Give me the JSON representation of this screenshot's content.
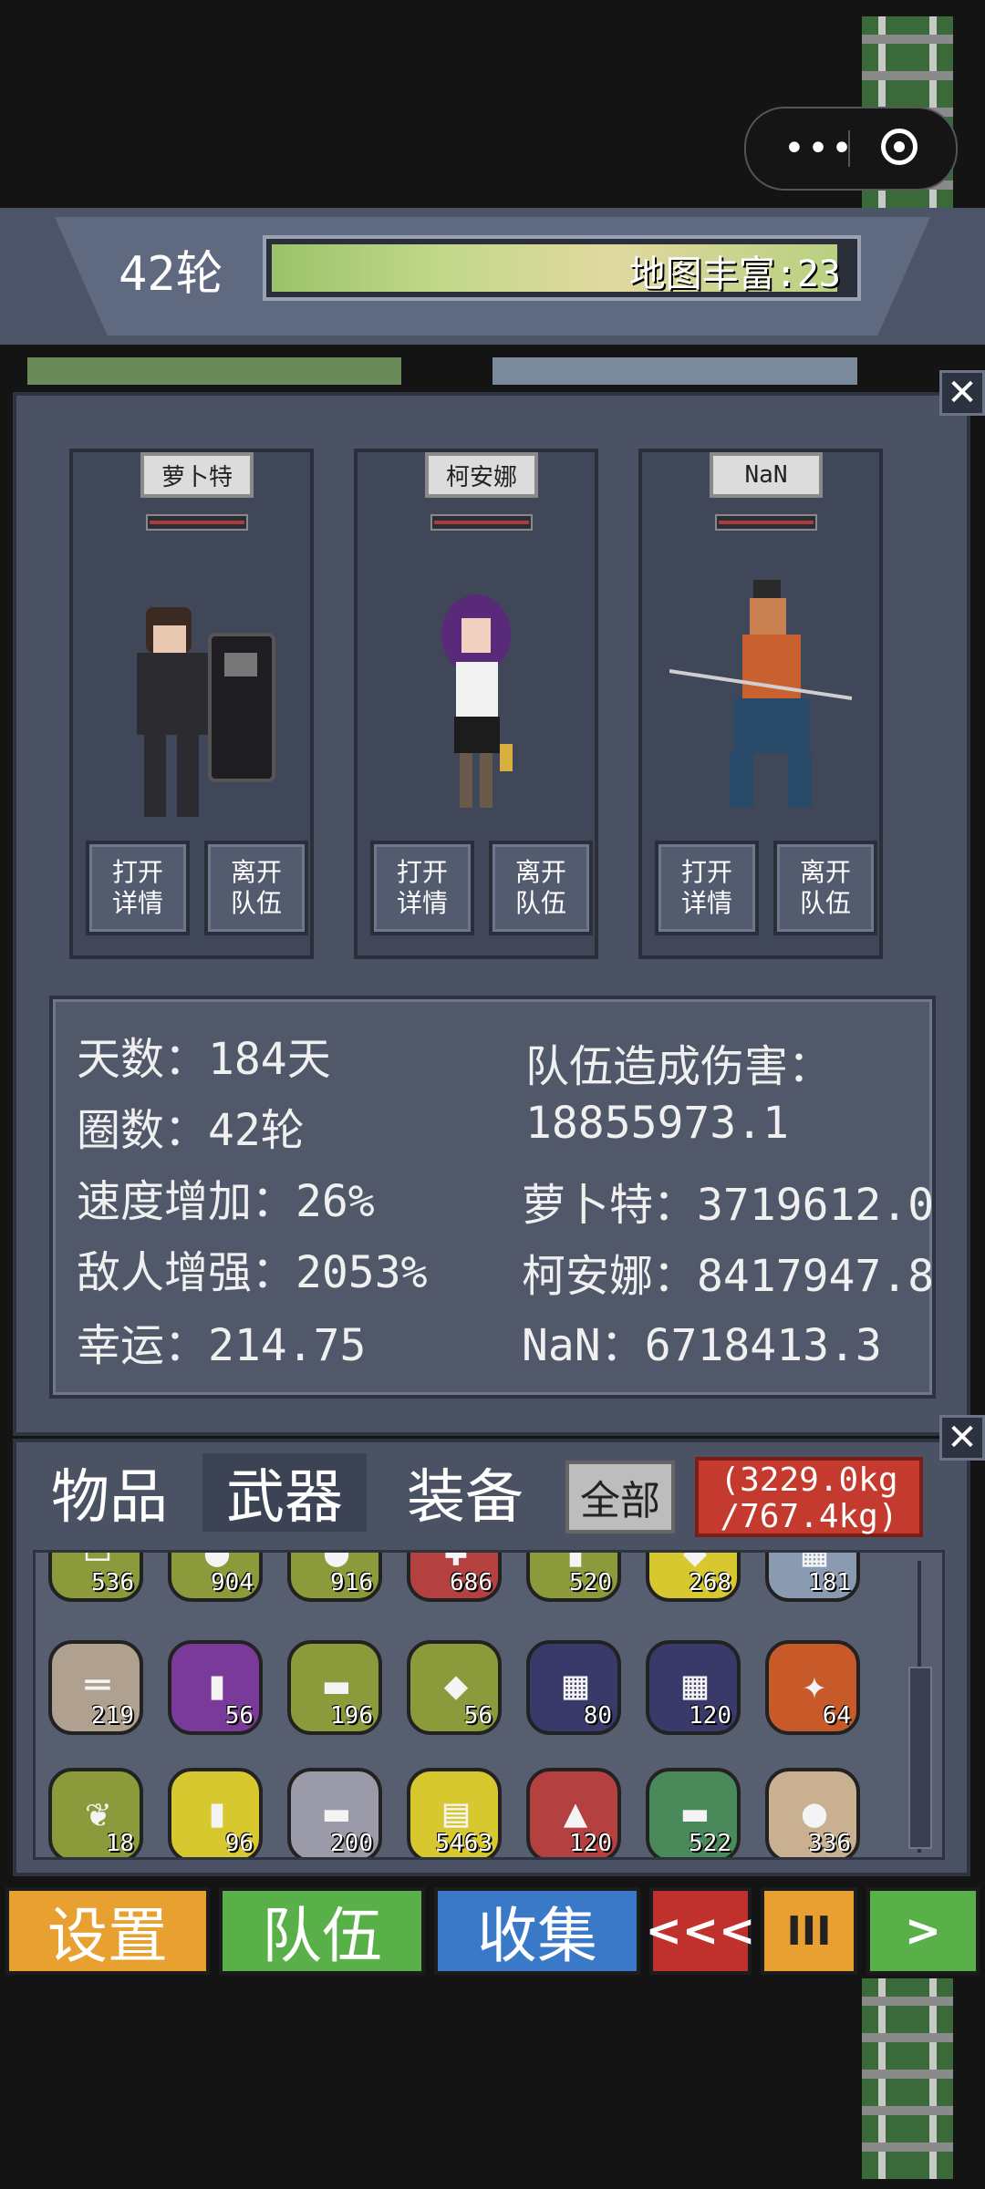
{
  "header": {
    "round": "42轮",
    "map_richness": "地图丰富:23"
  },
  "team": [
    {
      "name": "萝卜特",
      "open_label": "打开\n详情",
      "leave_label": "离开\n队伍"
    },
    {
      "name": "柯安娜",
      "open_label": "打开\n详情",
      "leave_label": "离开\n队伍"
    },
    {
      "name": "NaN",
      "open_label": "打开\n详情",
      "leave_label": "离开\n队伍"
    }
  ],
  "stats": {
    "days": "天数：184天",
    "rounds": "圈数：42轮",
    "speed": "速度增加：26%",
    "enemy": "敌人增强：2053%",
    "luck": "幸运：214.75",
    "damage_title": "队伍造成伤害：",
    "damage_total": "18855973.1",
    "damage_1": "萝卜特：3719612.0",
    "damage_2": "柯安娜：8417947.8",
    "damage_3": "NaN：6718413.3"
  },
  "inventory": {
    "tabs": [
      "物品",
      "武器",
      "装备"
    ],
    "all_label": "全部",
    "weight_line1": "(3229.0kg",
    "weight_line2": "/767.4kg)",
    "rows": [
      [
        {
          "icon": "paper-icon",
          "count": "536",
          "bg": "#8b9a3a"
        },
        {
          "icon": "egg-icon",
          "count": "904",
          "bg": "#8b9a3a"
        },
        {
          "icon": "fruit-icon",
          "count": "916",
          "bg": "#8b9a3a"
        },
        {
          "icon": "medkit-icon",
          "count": "686",
          "bg": "#b54040"
        },
        {
          "icon": "jar-icon",
          "count": "520",
          "bg": "#8b9a3a"
        },
        {
          "icon": "pill-icon",
          "count": "268",
          "bg": "#d8c830"
        },
        {
          "icon": "map-icon",
          "count": "181",
          "bg": "#8a9ab0"
        }
      ],
      [
        {
          "icon": "rifle-icon",
          "count": "219",
          "bg": "#b0a090"
        },
        {
          "icon": "can-icon",
          "count": "56",
          "bg": "#7a3a9a"
        },
        {
          "icon": "bandage-icon",
          "count": "196",
          "bg": "#8b9a3a"
        },
        {
          "icon": "meat-icon",
          "count": "56",
          "bg": "#8b9a3a"
        },
        {
          "icon": "blueprint-icon",
          "count": "80",
          "bg": "#3a3a6a"
        },
        {
          "icon": "blueprint-icon",
          "count": "120",
          "bg": "#3a3a6a"
        },
        {
          "icon": "claw-icon",
          "count": "64",
          "bg": "#c85a2a"
        }
      ],
      [
        {
          "icon": "herb-icon",
          "count": "18",
          "bg": "#8b9a3a"
        },
        {
          "icon": "bottle-icon",
          "count": "96",
          "bg": "#d8c830"
        },
        {
          "icon": "battery-icon",
          "count": "200",
          "bg": "#9a9aa8"
        },
        {
          "icon": "ticket-icon",
          "count": "5463",
          "bg": "#d8c830"
        },
        {
          "icon": "rocket-icon",
          "count": "120",
          "bg": "#b54040"
        },
        {
          "icon": "log-icon",
          "count": "522",
          "bg": "#4a8a5a"
        },
        {
          "icon": "stone-icon",
          "count": "336",
          "bg": "#c8b090"
        }
      ]
    ]
  },
  "bottom_bar": {
    "settings": "设置",
    "team": "队伍",
    "collect": "收集",
    "rewind": "<<<",
    "pause": "III",
    "play": ">"
  },
  "colors": {
    "settings": "#e8a030",
    "team": "#5ab048",
    "collect": "#3a78c8",
    "rewind": "#c0302c",
    "pause": "#e8a030",
    "play": "#5ab048"
  }
}
